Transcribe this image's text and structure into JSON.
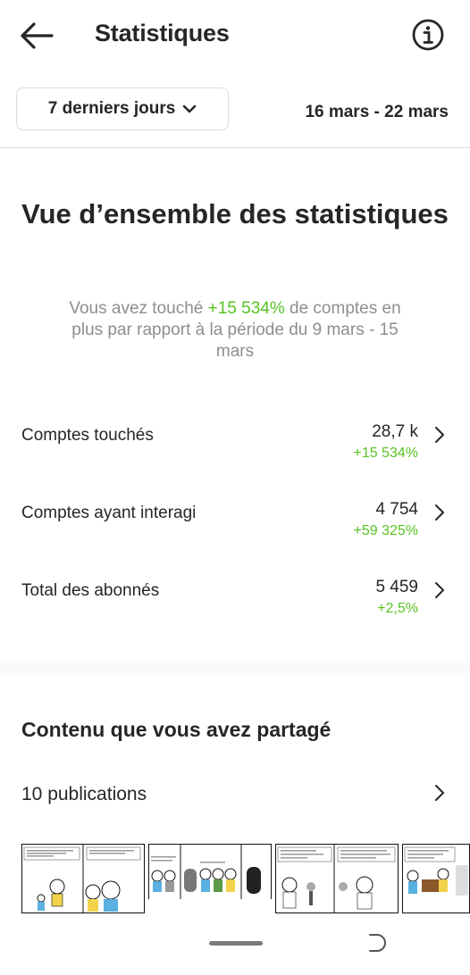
{
  "header": {
    "title": "Statistiques"
  },
  "filter": {
    "period_label": "7 derniers jours",
    "date_range": "16 mars - 22 mars"
  },
  "overview": {
    "title": "Vue d’ensemble des statistiques",
    "desc_prefix": "Vous avez touché ",
    "desc_highlight": "+15 534%",
    "desc_suffix": " de comptes en plus par rapport à la période du 9 mars - 15 mars"
  },
  "stats": [
    {
      "label": "Comptes touchés",
      "value": "28,7 k",
      "delta": "+15 534%"
    },
    {
      "label": "Comptes ayant interagi",
      "value": "4 754",
      "delta": "+59 325%"
    },
    {
      "label": "Total des abonnés",
      "value": "5 459",
      "delta": "+2,5%"
    }
  ],
  "content": {
    "title": "Contenu que vous avez partagé",
    "publications_label": "10 publications"
  },
  "colors": {
    "positive": "#58c322",
    "text": "#262626",
    "muted": "#8e8e8e",
    "border": "#dbdbdb"
  },
  "icons": {
    "back": "arrow-left-icon",
    "info": "info-circle-icon",
    "chevron": "chevron-right-icon",
    "dropdown": "chevron-down-icon"
  }
}
